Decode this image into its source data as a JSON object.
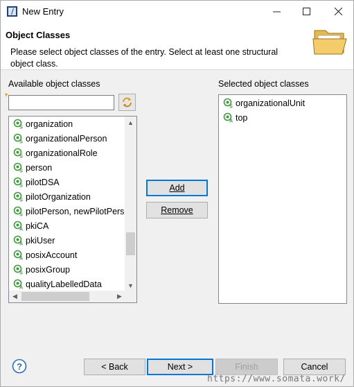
{
  "window": {
    "title": "New Entry"
  },
  "banner": {
    "title": "Object Classes",
    "description": "Please select object classes of the entry. Select at least one structural object class."
  },
  "available": {
    "label": "Available object classes",
    "filter_value": "",
    "items": [
      "organization",
      "organizationalPerson",
      "organizationalRole",
      "person",
      "pilotDSA",
      "pilotOrganization",
      "pilotPerson, newPilotPerson",
      "pkiCA",
      "pkiUser",
      "posixAccount",
      "posixGroup",
      "qualityLabelledData"
    ],
    "icon_markers": [
      "S",
      "S",
      "S",
      "S",
      "S",
      "S",
      "S",
      "A",
      "A",
      "A",
      "S",
      "A"
    ]
  },
  "selected": {
    "label": "Selected object classes",
    "items": [
      "organizationalUnit",
      "top"
    ],
    "icon_markers": [
      "S",
      "A"
    ]
  },
  "buttons": {
    "add": "Add",
    "remove": "Remove",
    "back": "< Back",
    "next": "Next >",
    "finish": "Finish",
    "cancel": "Cancel"
  },
  "watermark": "https://www.somata.work/",
  "colors": {
    "accent": "#0078d7",
    "icon_green": "#3c9a3c"
  }
}
